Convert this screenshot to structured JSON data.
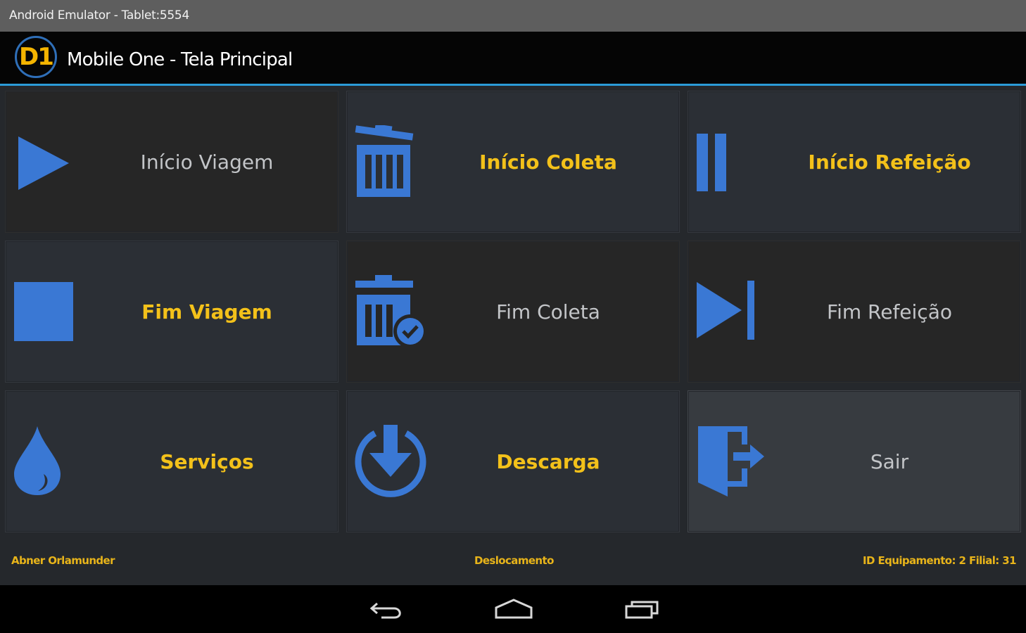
{
  "window": {
    "title": "Android Emulator - Tablet:5554"
  },
  "app_bar": {
    "logo_text": "D1",
    "title": "Mobile One - Tela Principal"
  },
  "tiles": [
    {
      "label": "Início Viagem",
      "icon": "play-icon"
    },
    {
      "label": "Início Coleta",
      "icon": "trash-open-icon"
    },
    {
      "label": "Início Refeição",
      "icon": "pause-icon"
    },
    {
      "label": "Fim Viagem",
      "icon": "stop-icon"
    },
    {
      "label": "Fim Coleta",
      "icon": "trash-check-icon"
    },
    {
      "label": "Fim Refeição",
      "icon": "skip-next-icon"
    },
    {
      "label": "Serviços",
      "icon": "water-drop-icon"
    },
    {
      "label": "Descarga",
      "icon": "download-circle-icon"
    },
    {
      "label": "Sair",
      "icon": "exit-door-icon"
    }
  ],
  "status_bar": {
    "user": "Abner Orlamunder",
    "state": "Deslocamento",
    "equipment": "ID Equipamento: 2 Filial: 31"
  },
  "nav": {
    "back": "back-icon",
    "home": "home-icon",
    "recents": "recents-icon"
  },
  "colors": {
    "accent": "#2b9bd8",
    "icon_blue": "#3a78d4",
    "label_yellow": "#f3c11a",
    "label_gray": "#c3c5c8",
    "logo_orange": "#f4b400"
  }
}
